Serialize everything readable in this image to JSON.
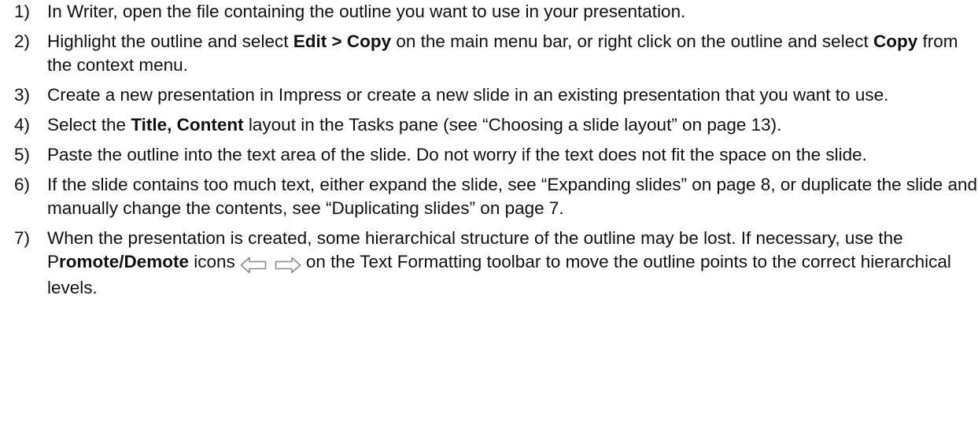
{
  "steps": [
    {
      "num": "1)",
      "parts": [
        {
          "t": "In Writer, open the file containing the outline you want to use in your presentation."
        }
      ]
    },
    {
      "num": "2)",
      "parts": [
        {
          "t": "Highlight the outline and select "
        },
        {
          "t": "Edit > Copy",
          "b": true
        },
        {
          "t": " on the main menu bar, or right click on the outline and select "
        },
        {
          "t": "Copy",
          "b": true
        },
        {
          "t": " from the context menu."
        }
      ]
    },
    {
      "num": "3)",
      "parts": [
        {
          "t": "Create a new presentation in Impress or create a new slide in an existing presentation that you want to use."
        }
      ]
    },
    {
      "num": "4)",
      "parts": [
        {
          "t": "Select the "
        },
        {
          "t": "Title, Content",
          "b": true
        },
        {
          "t": " layout in the Tasks pane (see “Choosing a slide layout” on page 13)."
        }
      ]
    },
    {
      "num": "5)",
      "parts": [
        {
          "t": "Paste the outline into the text area of the slide. Do not worry if the text does not fit the space on the slide."
        }
      ]
    },
    {
      "num": "6)",
      "parts": [
        {
          "t": "If the slide contains too much text, either expand the slide, see “Expanding slides” on page 8, or duplicate the slide and manually change the contents, see “Duplicating slides” on page 7."
        }
      ]
    },
    {
      "num": "7)",
      "parts": [
        {
          "t": "When the presentation is created, some hierarchical structure of the outline may be lost. If necessary, use the P"
        },
        {
          "t": "romote/Demote",
          "b": true
        },
        {
          "t": " icons"
        },
        {
          "icons": [
            "promote-icon",
            "demote-icon"
          ]
        },
        {
          "t": "on the Text Formatting toolbar to move the outline points to the correct hierarchical levels."
        }
      ]
    }
  ]
}
